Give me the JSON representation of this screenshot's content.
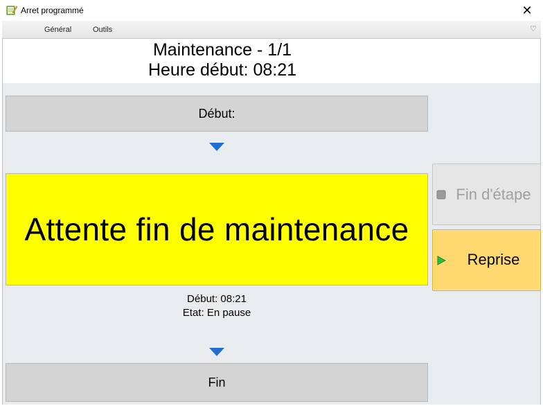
{
  "window": {
    "title": "Arret programmé",
    "close_glyph": "✕"
  },
  "ribbon": {
    "tabs": [
      {
        "label": "Général"
      },
      {
        "label": "Outils"
      }
    ],
    "collapse_glyph": "♡"
  },
  "header": {
    "line1": "Maintenance - 1/1",
    "line2": "Heure début: 08:21"
  },
  "steps": {
    "start_label": "Début:",
    "current_label": "Attente fin de maintenance",
    "current_info": {
      "start": "Début: 08:21",
      "state": "Etat: En pause"
    },
    "end_label": "Fin"
  },
  "actions": {
    "fin_etape_label": "Fin d'étape",
    "reprise_label": "Reprise"
  },
  "colors": {
    "current_step_bg": "#ffff00",
    "reprise_bg": "#ffd970",
    "arrow": "#1e6fd0",
    "play_icon": "#22aa22"
  },
  "icons": {
    "app": "notebook-pencil-icon",
    "arrows": "triangle-down-icon",
    "fin_etape": "stop-square-icon",
    "reprise": "play-triangle-icon"
  }
}
